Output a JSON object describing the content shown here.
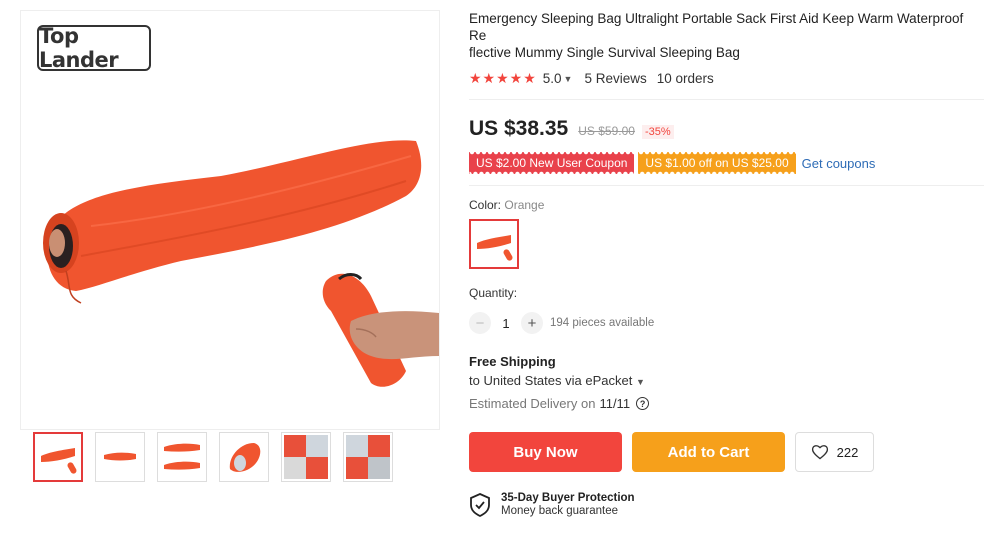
{
  "gallery": {
    "brand_logo": "Top Lander",
    "thumbnails": [
      {
        "name": "thumb-orange-bag-with-person"
      },
      {
        "name": "thumb-flat-bag"
      },
      {
        "name": "thumb-bag-side"
      },
      {
        "name": "thumb-bag-rolled"
      },
      {
        "name": "thumb-detail-collage"
      },
      {
        "name": "thumb-detail-collage-2"
      }
    ]
  },
  "product": {
    "title": "Emergency Sleeping Bag Ultralight Portable Sack First Aid Keep Warm Waterproof Re\nflective Mummy Single Survival Sleeping Bag",
    "rating": "5.0",
    "rating_stars": "★★★★★",
    "reviews": "5 Reviews",
    "orders": "10 orders",
    "price": "US $38.35",
    "old_price": "US $59.00",
    "discount": "-35%",
    "coupons": [
      "US $2.00 New User Coupon",
      "US $1.00 off on US $25.00"
    ],
    "get_coupons": "Get coupons",
    "color_label": "Color:",
    "color_value": "Orange",
    "quantity_label": "Quantity:",
    "quantity_value": "1",
    "minus": "−",
    "plus": "+",
    "available": "194 pieces available",
    "shipping_title": "Free Shipping",
    "shipping_line": "to United States via ePacket",
    "delivery_label": "Estimated Delivery on",
    "delivery_date": "11/11",
    "buy_now": "Buy Now",
    "add_to_cart": "Add to Cart",
    "wishlist_count": "222",
    "protection_title": "35-Day Buyer Protection",
    "protection_sub": "Money back guarantee"
  },
  "colors": {
    "accent_red": "#f2453d",
    "accent_orange": "#f6a01b",
    "link_blue": "#2e6cb6",
    "product_orange": "#f0552f"
  }
}
